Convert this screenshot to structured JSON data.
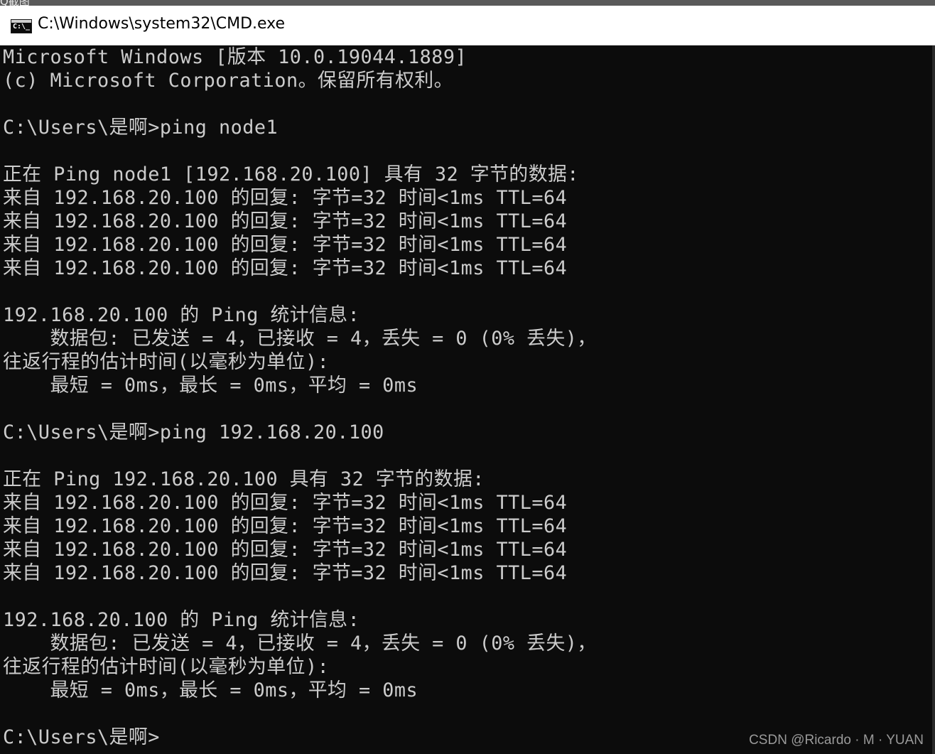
{
  "top_strip": {
    "text": "Q截图"
  },
  "titlebar": {
    "icon": "cmd-icon",
    "icon_glyph": "C:\\_",
    "title": "C:\\Windows\\system32\\CMD.exe"
  },
  "console": {
    "lines": [
      "Microsoft Windows [版本 10.0.19044.1889]",
      "(c) Microsoft Corporation。保留所有权利。",
      "",
      "C:\\Users\\是啊>ping node1",
      "",
      "正在 Ping node1 [192.168.20.100] 具有 32 字节的数据:",
      "来自 192.168.20.100 的回复: 字节=32 时间<1ms TTL=64",
      "来自 192.168.20.100 的回复: 字节=32 时间<1ms TTL=64",
      "来自 192.168.20.100 的回复: 字节=32 时间<1ms TTL=64",
      "来自 192.168.20.100 的回复: 字节=32 时间<1ms TTL=64",
      "",
      "192.168.20.100 的 Ping 统计信息:",
      "    数据包: 已发送 = 4，已接收 = 4，丢失 = 0 (0% 丢失)，",
      "往返行程的估计时间(以毫秒为单位):",
      "    最短 = 0ms，最长 = 0ms，平均 = 0ms",
      "",
      "C:\\Users\\是啊>ping 192.168.20.100",
      "",
      "正在 Ping 192.168.20.100 具有 32 字节的数据:",
      "来自 192.168.20.100 的回复: 字节=32 时间<1ms TTL=64",
      "来自 192.168.20.100 的回复: 字节=32 时间<1ms TTL=64",
      "来自 192.168.20.100 的回复: 字节=32 时间<1ms TTL=64",
      "来自 192.168.20.100 的回复: 字节=32 时间<1ms TTL=64",
      "",
      "192.168.20.100 的 Ping 统计信息:",
      "    数据包: 已发送 = 4，已接收 = 4，丢失 = 0 (0% 丢失)，",
      "往返行程的估计时间(以毫秒为单位):",
      "    最短 = 0ms，最长 = 0ms，平均 = 0ms",
      "",
      "C:\\Users\\是啊>"
    ]
  },
  "watermark": {
    "text": "CSDN @Ricardo · M · YUAN"
  },
  "colors": {
    "console_background": "#0c0c0c",
    "console_text": "#cccccc",
    "titlebar_background": "#ffffff",
    "titlebar_text": "#000000"
  }
}
